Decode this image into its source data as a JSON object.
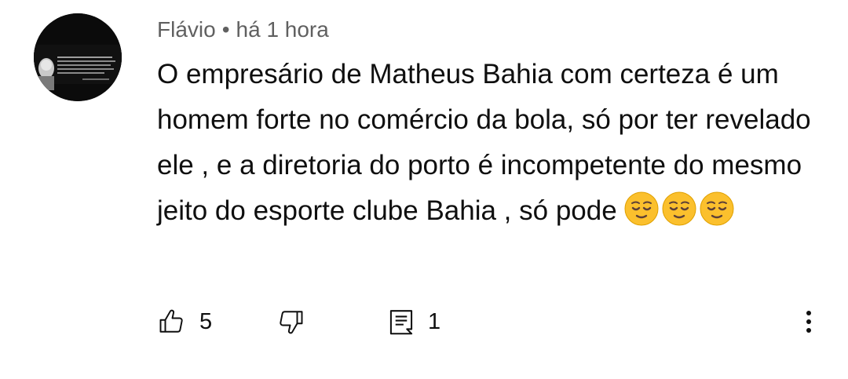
{
  "comment": {
    "author": "Flávio",
    "separator": "•",
    "time": "há 1 hora",
    "text": "O empresário de Matheus Bahia com certeza é um homem forte no comércio da bola, só por ter revelado ele , e a diretoria do porto é incompetente do mesmo jeito do esporte clube Bahia , só pode",
    "emoji": [
      "relieved-face",
      "relieved-face",
      "relieved-face"
    ],
    "likes": "5",
    "replies": "1"
  },
  "icons": {
    "like": "thumbs-up-icon",
    "dislike": "thumbs-down-icon",
    "reply": "reply-comment-icon",
    "more": "more-vertical-icon"
  },
  "colors": {
    "meta_text": "#606060",
    "body_text": "#0f0f0f",
    "avatar_bg": "#0a0a0a",
    "emoji_yellow": "#fbc02d"
  }
}
